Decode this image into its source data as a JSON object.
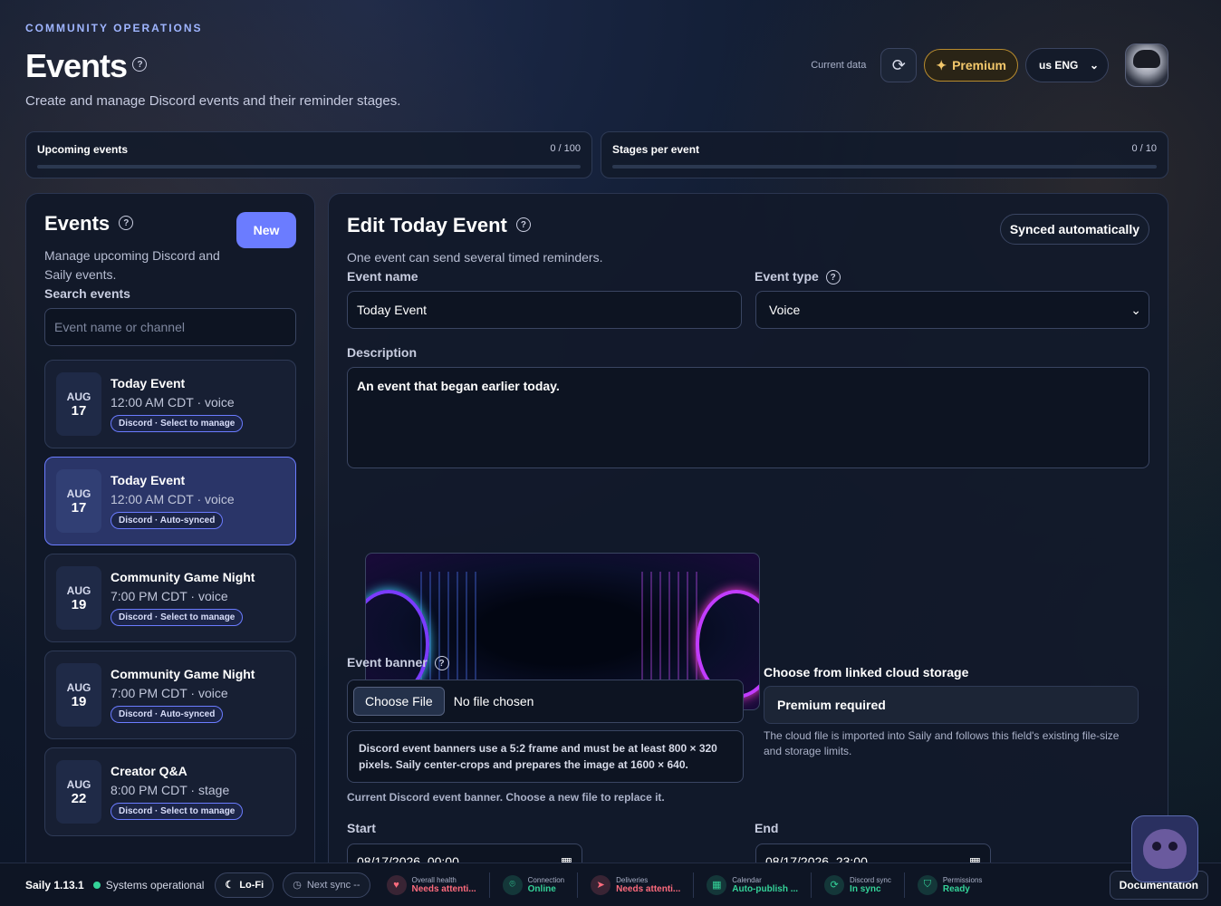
{
  "header": {
    "kicker": "COMMUNITY OPERATIONS",
    "title": "Events",
    "subtitle": "Create and manage Discord events and their reminder stages.",
    "current_data_label": "Current data",
    "premium_label": "Premium",
    "language": "us ENG"
  },
  "stats": [
    {
      "label": "Upcoming events",
      "value": "0 / 100",
      "fill": 0
    },
    {
      "label": "Stages per event",
      "value": "0 / 10",
      "fill": 0
    }
  ],
  "sidebar": {
    "title": "Events",
    "new_label": "New",
    "description": "Manage upcoming Discord and Saily events.",
    "search_label": "Search events",
    "search_placeholder": "Event name or channel",
    "events": [
      {
        "month": "AUG",
        "day": "17",
        "name": "Today Event",
        "meta": "12:00 AM CDT · voice",
        "tag": "Discord · Select to manage",
        "selected": false
      },
      {
        "month": "AUG",
        "day": "17",
        "name": "Today Event",
        "meta": "12:00 AM CDT · voice",
        "tag": "Discord · Auto-synced",
        "selected": true
      },
      {
        "month": "AUG",
        "day": "19",
        "name": "Community Game Night",
        "meta": "7:00 PM CDT · voice",
        "tag": "Discord · Select to manage",
        "selected": false
      },
      {
        "month": "AUG",
        "day": "19",
        "name": "Community Game Night",
        "meta": "7:00 PM CDT · voice",
        "tag": "Discord · Auto-synced",
        "selected": false
      },
      {
        "month": "AUG",
        "day": "22",
        "name": "Creator Q&A",
        "meta": "8:00 PM CDT · stage",
        "tag": "Discord · Select to manage",
        "selected": false
      }
    ]
  },
  "editor": {
    "title": "Edit Today Event",
    "synced_label": "Synced automatically",
    "subtitle": "One event can send several timed reminders.",
    "name_label": "Event name",
    "name_value": "Today Event",
    "type_label": "Event type",
    "type_value": "Voice",
    "description_label": "Description",
    "description_value": "An event that began earlier today.",
    "banner_label": "Event banner",
    "choose_file_label": "Choose File",
    "no_file_label": "No file chosen",
    "banner_info": "Discord event banners use a 5:2 frame and must be at least 800 × 320 pixels. Saily center-crops and prepares the image at 1600 × 640.",
    "banner_hint": "Current Discord event banner. Choose a new file to replace it.",
    "cloud_title": "Choose from linked cloud storage",
    "cloud_button": "Premium required",
    "cloud_note": "The cloud file is imported into Saily and follows this field's existing file-size and storage limits.",
    "start_label": "Start",
    "start_value": "08/17/2026, 00:00",
    "end_label": "End",
    "end_value": "08/17/2026, 23:00"
  },
  "footer": {
    "version": "Saily 1.13.1",
    "system_status": "Systems operational",
    "lofi_label": "Lo-Fi",
    "next_sync_label": "Next sync --",
    "statuses": [
      {
        "label": "Overall health",
        "value": "Needs attenti...",
        "color": "#ff6b7d",
        "icon": "heart-icon"
      },
      {
        "label": "Connection",
        "value": "Online",
        "color": "#34d399",
        "icon": "signal-icon"
      },
      {
        "label": "Deliveries",
        "value": "Needs attenti...",
        "color": "#ff6b7d",
        "icon": "send-icon"
      },
      {
        "label": "Calendar",
        "value": "Auto-publish ...",
        "color": "#34d399",
        "icon": "calendar-icon"
      },
      {
        "label": "Discord sync",
        "value": "In sync",
        "color": "#34d399",
        "icon": "sync-icon"
      },
      {
        "label": "Permissions",
        "value": "Ready",
        "color": "#34d399",
        "icon": "shield-icon"
      }
    ],
    "docs_label": "Documentation"
  }
}
